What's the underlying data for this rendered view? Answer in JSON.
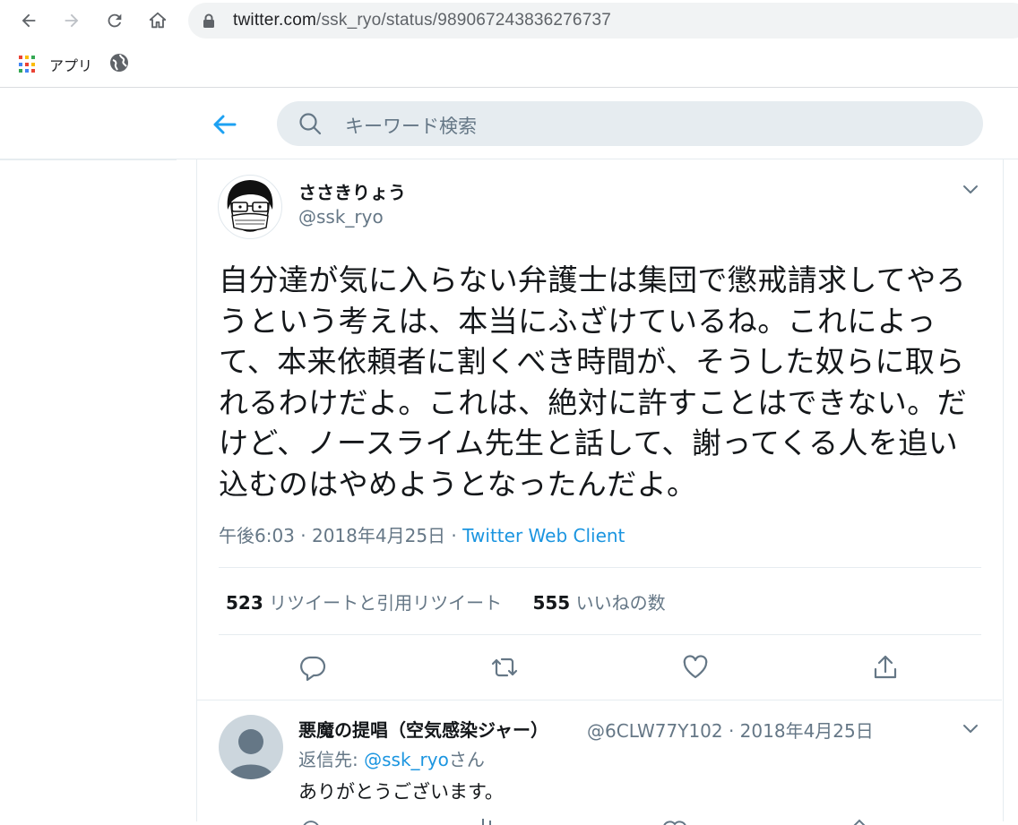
{
  "browser": {
    "url_domain": "twitter.com",
    "url_path": "/ssk_ryo/status/989067243836276737",
    "bookmark_apps_label": "アプリ",
    "colors": {
      "apps": [
        "#ea4335",
        "#fbbc05",
        "#34a853",
        "#4285f4",
        "#ea4335",
        "#fbbc05",
        "#34a853",
        "#4285f4",
        "#ea4335"
      ]
    }
  },
  "header": {
    "search_placeholder": "キーワード検索"
  },
  "tweet": {
    "author_name": "ささきりょう",
    "author_handle": "@ssk_ryo",
    "text": "自分達が気に入らない弁護士は集団で懲戒請求してやろうという考えは、本当にふざけているね。これによって、本来依頼者に割くべき時間が、そうした奴らに取られるわけだよ。これは、絶対に許すことはできない。だけど、ノースライム先生と話して、謝ってくる人を追い込むのはやめようとなったんだよ。",
    "timestamp": "午後6:03 · 2018年4月25日 · ",
    "client": "Twitter Web Client",
    "retweet_count": "523",
    "retweet_label": "リツイートと引用リツイート",
    "like_count": "555",
    "like_label": "いいねの数"
  },
  "reply": {
    "author_name": "悪魔の提唱（空気感染ジャー）",
    "meta": "@6CLW77Y102 · 2018年4月25日",
    "reply_to_prefix": "返信先: ",
    "reply_to_handle": "@ssk_ryo",
    "reply_to_suffix": "さん",
    "text": "ありがとうございます。"
  },
  "colors": {
    "accent": "#1da1f2",
    "link": "#1b95e0",
    "muted": "#657786"
  }
}
